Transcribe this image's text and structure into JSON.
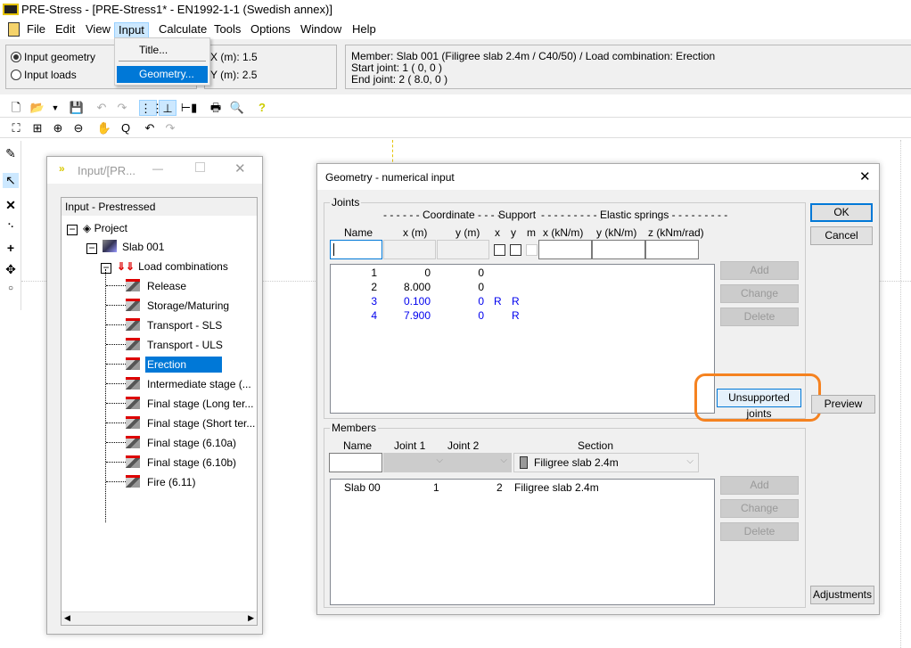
{
  "app": {
    "title": "PRE-Stress  - [PRE-Stress1* - EN1992-1-1 (Swedish annex)]"
  },
  "menu": [
    "File",
    "Edit",
    "View",
    "Input",
    "Calculate",
    "Tools",
    "Options",
    "Window",
    "Help"
  ],
  "input_menu": {
    "items": [
      "Title...",
      "Geometry..."
    ],
    "selected": "Geometry..."
  },
  "mode": {
    "options": [
      "Input geometry",
      "Input loads"
    ],
    "selected": "Input geometry"
  },
  "coords": {
    "x": "X (m): 1.5",
    "y": "Y (m): 2.5"
  },
  "info": {
    "line1": "Member: Slab 001  (Filigree slab 2.4m / C40/50) / Load combination: Erection",
    "line2": "Start joint: 1  ( 0, 0 )",
    "line3": "End joint: 2  ( 8.0, 0 )"
  },
  "input_window": {
    "title": "Input/[PR...",
    "panel_title": "Input - Prestressed",
    "tree": {
      "project": "Project",
      "member": "Slab 001",
      "group": "Load combinations",
      "items": [
        "Release",
        "Storage/Maturing",
        "Transport - SLS",
        "Transport - ULS",
        "Erection",
        "Intermediate stage (...",
        "Final stage (Long ter...",
        "Final stage (Short ter...",
        "Final stage (6.10a)",
        "Final stage (6.10b)",
        "Fire (6.11)"
      ],
      "selected": "Erection"
    }
  },
  "dialog": {
    "title": "Geometry - numerical input",
    "ok": "OK",
    "cancel": "Cancel",
    "preview": "Preview",
    "adjustments": "Adjustments",
    "joints": {
      "legend": "Joints",
      "group_coordinate": "- - - - - - Coordinate - - - -",
      "group_support": "Support",
      "group_springs": "- - - - - - - - - Elastic springs - - - - - - - - -",
      "headers": [
        "Name",
        "x (m)",
        "y (m)",
        "x",
        "y",
        "m",
        "x (kN/m)",
        "y (kN/m)",
        "z (kNm/rad)"
      ],
      "rows": [
        {
          "name": "1",
          "x": "0",
          "y": "0",
          "sx": "",
          "sy": "",
          "highlight": false
        },
        {
          "name": "2",
          "x": "8.000",
          "y": "0",
          "sx": "",
          "sy": "",
          "highlight": false
        },
        {
          "name": "3",
          "x": "0.100",
          "y": "0",
          "sx": "R",
          "sy": "R",
          "highlight": true
        },
        {
          "name": "4",
          "x": "7.900",
          "y": "0",
          "sx": "",
          "sy": "R",
          "highlight": true
        }
      ],
      "add": "Add",
      "change": "Change",
      "delete": "Delete",
      "unsupported": "Unsupported joints"
    },
    "members": {
      "legend": "Members",
      "headers": [
        "Name",
        "Joint 1",
        "Joint 2",
        "Section"
      ],
      "section_value": "Filigree slab 2.4m",
      "rows": [
        {
          "name": "Slab 00",
          "j1": "1",
          "j2": "2",
          "section": "Filigree slab 2.4m"
        }
      ],
      "add": "Add",
      "change": "Change",
      "delete": "Delete"
    }
  },
  "colors": {
    "selection": "#0078d7",
    "highlight_outline": "#f58220",
    "joint_highlight": "#0000ee"
  }
}
